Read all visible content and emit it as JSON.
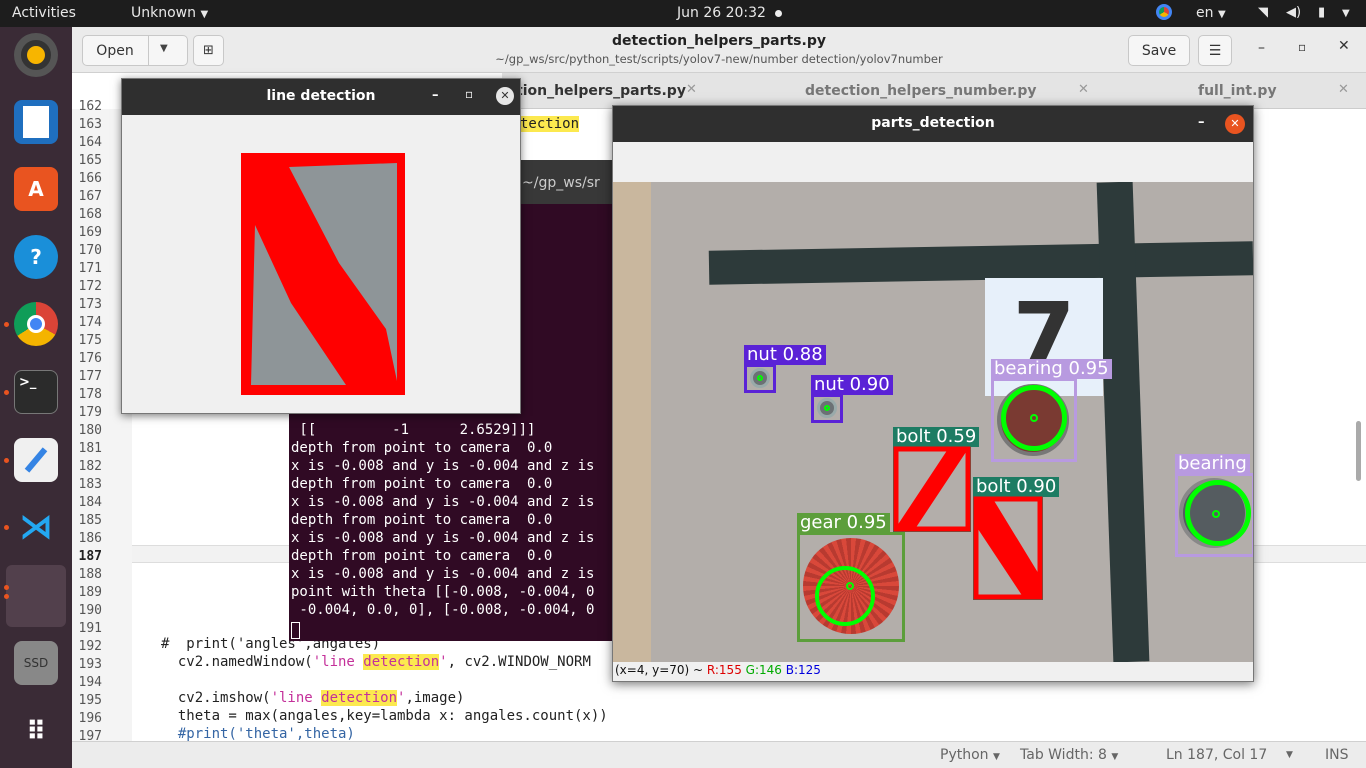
{
  "topbar": {
    "activities": "Activities",
    "app_menu": "Unknown",
    "datetime": "Jun 26  20:32",
    "lang": "en"
  },
  "dock": {
    "items": [
      "rhythmbox",
      "writer",
      "software",
      "help",
      "chrome",
      "terminal",
      "text-editor",
      "vscode",
      "apps",
      "ssd",
      "show-apps"
    ],
    "ssd_label": "SSD"
  },
  "editor": {
    "open_label": "Open",
    "title": "detection_helpers_parts.py",
    "path": "~/gp_ws/src/python_test/scripts/yolov7-new/number detection/yolov7number",
    "save_label": "Save",
    "tabs": [
      {
        "label": "detection_helpers_parts.py"
      },
      {
        "label": "detection_helpers_number.py"
      },
      {
        "label": "full_int.py"
      }
    ],
    "line_numbers": [
      "162",
      "163",
      "164",
      "165",
      "166",
      "167",
      "168",
      "169",
      "170",
      "171",
      "172",
      "173",
      "174",
      "175",
      "176",
      "177",
      "178",
      "179",
      "180",
      "181",
      "182",
      "183",
      "184",
      "185",
      "186",
      "187",
      "188",
      "189",
      "190",
      "191",
      "192",
      "193",
      "194",
      "195",
      "196",
      "197"
    ],
    "visible_code": {
      "l163": "tection",
      "l192_a": "#  print('angles',angales)",
      "l193_a": "  cv2.namedWindow(",
      "l193_str": "'line ",
      "l193_hl": "detection",
      "l193_b": "', cv2.WINDOW_NORM",
      "l195_a": "  cv2.imshow(",
      "l195_str": "'line ",
      "l195_hl": "detection",
      "l195_b": "',image)",
      "l196": "  theta = max(angales,key=lambda x: angales.count(x))",
      "l197": "  #print('theta',theta)"
    },
    "status": {
      "language": "Python",
      "tab_width": "Tab Width: 8",
      "position": "Ln 187, Col 17",
      "mode": "INS"
    }
  },
  "terminal": {
    "title_fragment": "l: ~/gp_ws/sr",
    "lines": [
      "                        ]]",
      "",
      "                        ]]",
      "",
      "                        ]]",
      "",
      "                        ]]",
      "",
      "                        ]]",
      "",
      "                        ]]",
      "",
      " [[         -1      2.6529]]]",
      "depth from point to camera  0.0",
      "x is -0.008 and y is -0.004 and z is",
      "depth from point to camera  0.0",
      "x is -0.008 and y is -0.004 and z is",
      "depth from point to camera  0.0",
      "x is -0.008 and y is -0.004 and z is",
      "depth from point to camera  0.0",
      "x is -0.008 and y is -0.004 and z is",
      "point with theta [[-0.008, -0.004, 0",
      " -0.004, 0.0, 0], [-0.008, -0.004, 0"
    ]
  },
  "line_window": {
    "title": "line detection"
  },
  "parts_window": {
    "title": "parts_detection",
    "detections": [
      {
        "label": "nut 0.88",
        "color": "#5a22d6"
      },
      {
        "label": "nut 0.90",
        "color": "#5a22d6"
      },
      {
        "label": "bearing 0.95",
        "color": "#b89ae0"
      },
      {
        "label": "bearing",
        "color": "#b89ae0"
      },
      {
        "label": "bolt 0.59",
        "color": "#1d7c63"
      },
      {
        "label": "bolt 0.90",
        "color": "#1d7c63"
      },
      {
        "label": "gear 0.95",
        "color": "#5c9e3b"
      }
    ],
    "sign_number": "7",
    "pixel_info": {
      "coords": "(x=4, y=70) ~",
      "r": "R:155",
      "g": "G:146",
      "b": "B:125"
    }
  }
}
